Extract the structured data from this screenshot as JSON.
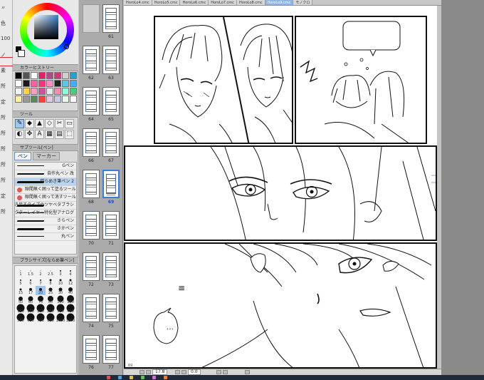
{
  "left_strip": {
    "labels": [
      "〃",
      "色",
      "100",
      "ノ",
      "素",
      "所",
      "定",
      "所",
      "所",
      "所",
      "所",
      "所",
      "定",
      "所"
    ]
  },
  "color_history": {
    "title": "カラーヒストリー",
    "swatches": [
      "#000000",
      "#555555",
      "#ffffff",
      "#e61f6d",
      "#b04a8c",
      "#c93a7a",
      "#d0d0d0",
      "#2aa0c8",
      "#ffffff",
      "#1a1a1a",
      "#ff5fa0",
      "#ff2f80",
      "#ff8cc0",
      "#222222",
      "#5cc6e8",
      "#3fb0ff",
      "#f5f5f5",
      "#ffd24a",
      "#f7a0c0",
      "#d74fa0",
      "#e8e8e8",
      "#ff89b5",
      "#88ffd8",
      "#48d078",
      "#fff1a8",
      "#9a9a9a",
      "#5a8c5a",
      "#ff3f3f",
      "#e0c8e0",
      "#c8c8e8",
      "#e8f8e8",
      "#ffffff"
    ]
  },
  "tool_panel": {
    "title": "ツール",
    "icons": [
      "pen-tool-icon",
      "brush-tool-icon",
      "fill-tool-icon",
      "eraser-tool-icon",
      "lasso-tool-icon",
      "shape-tool-icon",
      "eyedropper-tool-icon",
      "move-tool-icon",
      "text-tool-icon",
      "frame-tool-icon",
      "gradient-tool-icon",
      "select-tool-icon"
    ],
    "glyphs": [
      "✎",
      "◆",
      "▲",
      "◇",
      "✂",
      "▭",
      "◐",
      "✥",
      "A",
      "▦",
      "▤",
      "⬚"
    ]
  },
  "subtool": {
    "title": "サブツール[ペン]",
    "tabs": [
      "ペン",
      "マーカー"
    ],
    "brushes": [
      {
        "name": "Gペン",
        "red": false,
        "selected": false
      },
      {
        "name": "自作丸ペン 改",
        "red": false,
        "selected": false
      },
      {
        "name": "揺らめき筆ペン 2",
        "red": false,
        "selected": true
      },
      {
        "name": "隙間無く囲って塗るツール",
        "red": true,
        "selected": false
      },
      {
        "name": "隙間無く囲って消すツール",
        "red": true,
        "selected": false
      },
      {
        "name": "描き足すタイプのツヤベタブラシ",
        "red": false,
        "selected": false
      },
      {
        "name": "ベクターレイヤー特化型アナログ",
        "red": false,
        "selected": false
      },
      {
        "name": "さらペン",
        "red": false,
        "selected": false
      },
      {
        "name": "さかペン",
        "red": false,
        "selected": false
      },
      {
        "name": "丸ペン",
        "red": false,
        "selected": false
      }
    ]
  },
  "brush_size": {
    "title": "ブラシサイズ[ならめ筆ペン]",
    "sizes": [
      "1",
      "1.5",
      "2",
      "2.5",
      "3",
      "4",
      "5",
      "6",
      "7",
      "8",
      "10",
      "12",
      "15",
      "17",
      "20",
      "25",
      "30",
      "40",
      "50",
      "60",
      "70",
      "80",
      "100",
      "120",
      "150",
      "170",
      "200",
      "250",
      "300",
      "400",
      "500",
      "600",
      "700",
      "800",
      "1000",
      "1200"
    ],
    "active_index": 14
  },
  "pages": {
    "thumbnails": [
      {
        "left": "",
        "right": "61"
      },
      {
        "left": "62",
        "right": "63"
      },
      {
        "left": "64",
        "right": "65"
      },
      {
        "left": "66",
        "right": "67"
      },
      {
        "left": "68",
        "right": "69"
      },
      {
        "left": "70",
        "right": "71"
      },
      {
        "left": "72",
        "right": "73"
      },
      {
        "left": "74",
        "right": "75"
      },
      {
        "left": "76",
        "right": "77"
      }
    ],
    "selected": "69"
  },
  "doc_tabs": [
    "HoroLo4.cmc",
    "HoroLo5.cmc",
    "HoroLo6.cmc",
    "HoroLo7.cmc",
    "HoroLo8.cmc",
    "HoroLo9.cmc",
    "モノクロ"
  ],
  "active_doc_tab": 5,
  "canvas": {
    "page_number": "69",
    "speech_mark": "…",
    "tick_marks": "≡"
  },
  "status": {
    "zoom": "17.8",
    "angle": "0.0"
  },
  "colors": {
    "accent": "#3d7bd9",
    "panel_bg": "#d9d9d9",
    "page_panel_bg": "#aaaaaa"
  }
}
